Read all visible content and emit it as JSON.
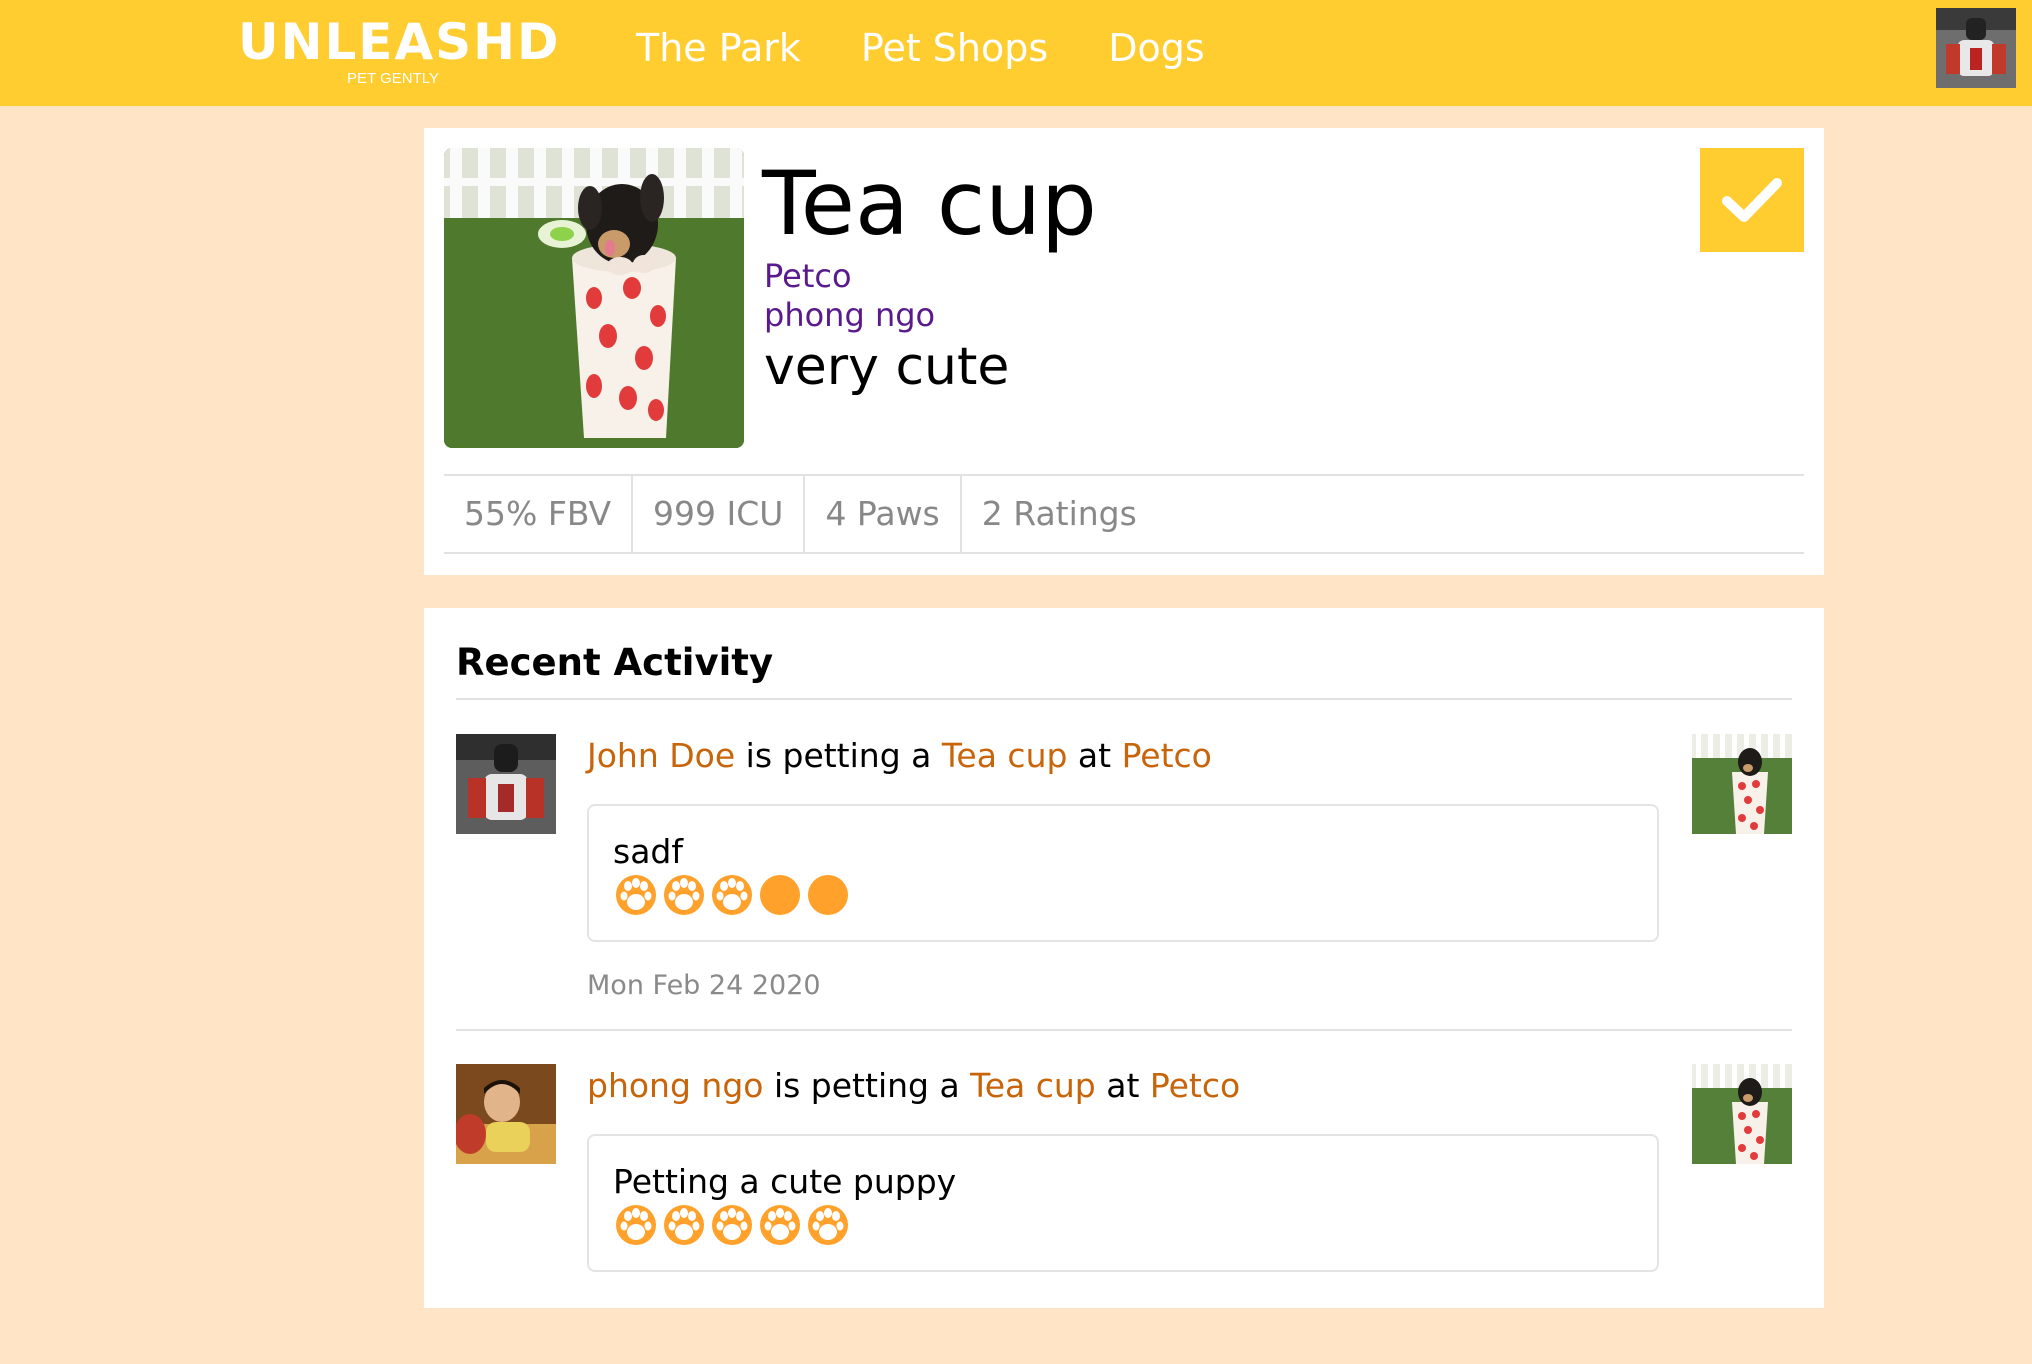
{
  "nav": {
    "brand": "UNLEASHD",
    "tagline": "PET GENTLY",
    "links": [
      "The Park",
      "Pet Shops",
      "Dogs"
    ]
  },
  "dog": {
    "name": "Tea cup",
    "shop": "Petco",
    "owner": "phong ngo",
    "description": "very cute",
    "stats": [
      "55% FBV",
      "999 ICU",
      "4 Paws",
      "2 Ratings"
    ]
  },
  "activity": {
    "title": "Recent Activity",
    "entries": [
      {
        "user": "John Doe",
        "verb": " is petting a ",
        "dog": "Tea cup",
        "prep": " at ",
        "shop": "Petco",
        "review": "sadf",
        "rating": 3,
        "max_rating": 5,
        "date": "Mon Feb 24 2020"
      },
      {
        "user": "phong ngo",
        "verb": " is petting a ",
        "dog": "Tea cup",
        "prep": " at ",
        "shop": "Petco",
        "review": "Petting a cute puppy",
        "rating": 5,
        "max_rating": 5,
        "date": ""
      }
    ]
  },
  "colors": {
    "nav_bg": "#ffcd30",
    "page_bg": "#ffe5c6",
    "link_orange": "#c8650a",
    "link_purple": "#5a1a8c",
    "paw": "#ffa12a"
  },
  "icons": {
    "check": "check-icon",
    "paw_filled": "paw-icon",
    "paw_empty": "circle-icon"
  }
}
